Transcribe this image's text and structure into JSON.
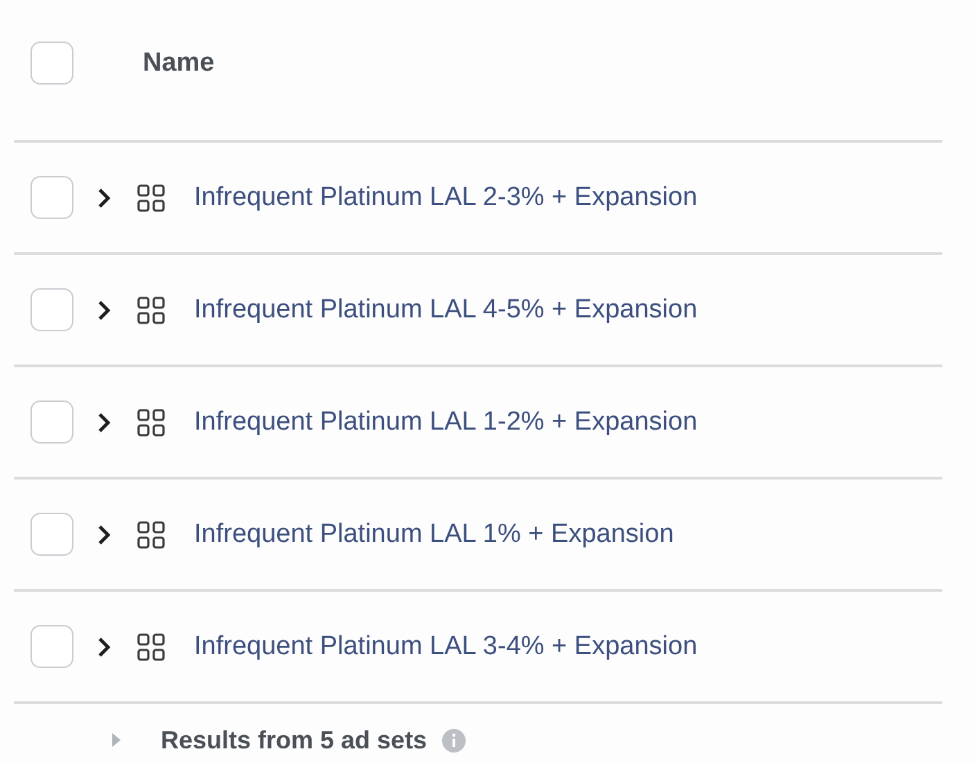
{
  "header": {
    "checked": false,
    "label": "Name"
  },
  "rows": [
    {
      "name": "Infrequent Platinum LAL 2-3% + Expansion",
      "checked": false,
      "expanded": false
    },
    {
      "name": "Infrequent Platinum LAL 4-5% + Expansion",
      "checked": false,
      "expanded": false
    },
    {
      "name": "Infrequent Platinum LAL 1-2% + Expansion",
      "checked": false,
      "expanded": false
    },
    {
      "name": "Infrequent Platinum LAL 1% + Expansion",
      "checked": false,
      "expanded": false
    },
    {
      "name": "Infrequent Platinum LAL 3-4% + Expansion",
      "checked": false,
      "expanded": false
    }
  ],
  "footer": {
    "label": "Results from 5 ad sets",
    "expanded": false
  }
}
